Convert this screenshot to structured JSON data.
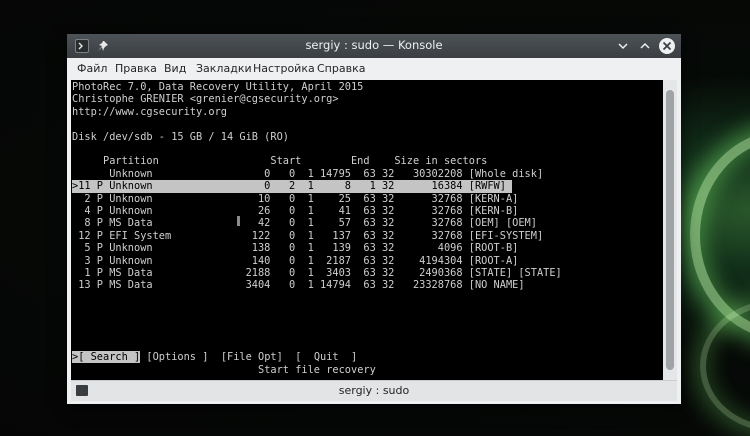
{
  "window": {
    "title": "sergiy : sudo — Konsole"
  },
  "menu": [
    "Файл",
    "Правка",
    "Вид",
    "Закладки",
    "Настройка",
    "Справка"
  ],
  "terminal": {
    "lines": [
      "PhotoRec 7.0, Data Recovery Utility, April 2015",
      "Christophe GRENIER <grenier@cgsecurity.org>",
      "http://www.cgsecurity.org",
      "",
      "Disk /dev/sdb - 15 GB / 14 GiB (RO)",
      "",
      "     Partition                  Start        End    Size in sectors",
      "      Unknown                  0   0  1 14795  63 32   30302208 [Whole disk]",
      ">11 P Unknown                  0   2  1     8   1 32      16384 [RWFW]",
      "  2 P Unknown                 10   0  1    25  63 32      32768 [KERN-A]",
      "  4 P Unknown                 26   0  1    41  63 32      32768 [KERN-B]",
      "  8 P MS Data                 42   0  1    57  63 32      32768 [OEM] [OEM]",
      " 12 P EFI System             122   0  1   137  63 32      32768 [EFI-SYSTEM]",
      "  5 P Unknown                138   0  1   139  63 32       4096 [ROOT-B]",
      "  3 P Unknown                140   0  1  2187  63 32    4194304 [ROOT-A]",
      "  1 P MS Data               2188   0  1  3403  63 32    2490368 [STATE] [STATE]",
      " 13 P MS Data               3404   0  1 14794  63 32   23328768 [NO NAME]"
    ],
    "selected_line": ">11 P Unknown                  0   2  1     8   1 32      16384 [RWFW]",
    "actions": {
      "search": ">[ Search ]",
      "options": " [Options ]",
      "file_opt": "[File Opt]",
      "quit": "[  Quit  ]"
    },
    "hint": "Start file recovery"
  },
  "tab": {
    "label": "sergiy : sudo"
  }
}
